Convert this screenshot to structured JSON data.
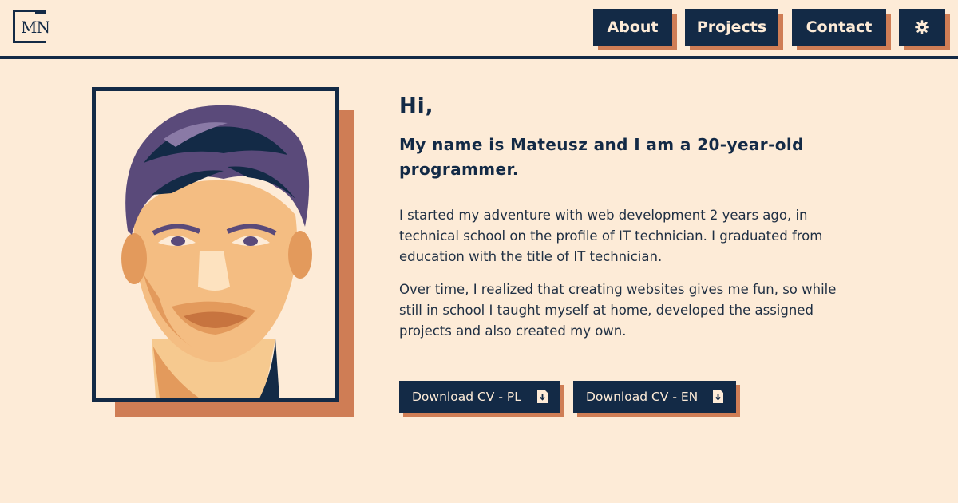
{
  "logo": {
    "text": "MN"
  },
  "nav": {
    "about": "About",
    "projects": "Projects",
    "contact": "Contact",
    "theme_icon": "gear-icon"
  },
  "hero": {
    "greeting": "Hi,",
    "intro": "My name is Mateusz and I am a 20-year-old programmer.",
    "paragraph1": "I started my adventure with web development 2 years ago, in technical school on the profile of IT technician. I graduated from education with the title of IT technician.",
    "paragraph2": "Over time, I realized that creating websites gives me fun, so while still in school I taught myself at home, developed the assigned projects and also created my own."
  },
  "downloads": {
    "pl": "Download CV - PL",
    "en": "Download CV - EN",
    "icon": "file-download-icon"
  },
  "colors": {
    "background": "#fdebd7",
    "navy": "#132a46",
    "accent": "#cf7d55"
  }
}
